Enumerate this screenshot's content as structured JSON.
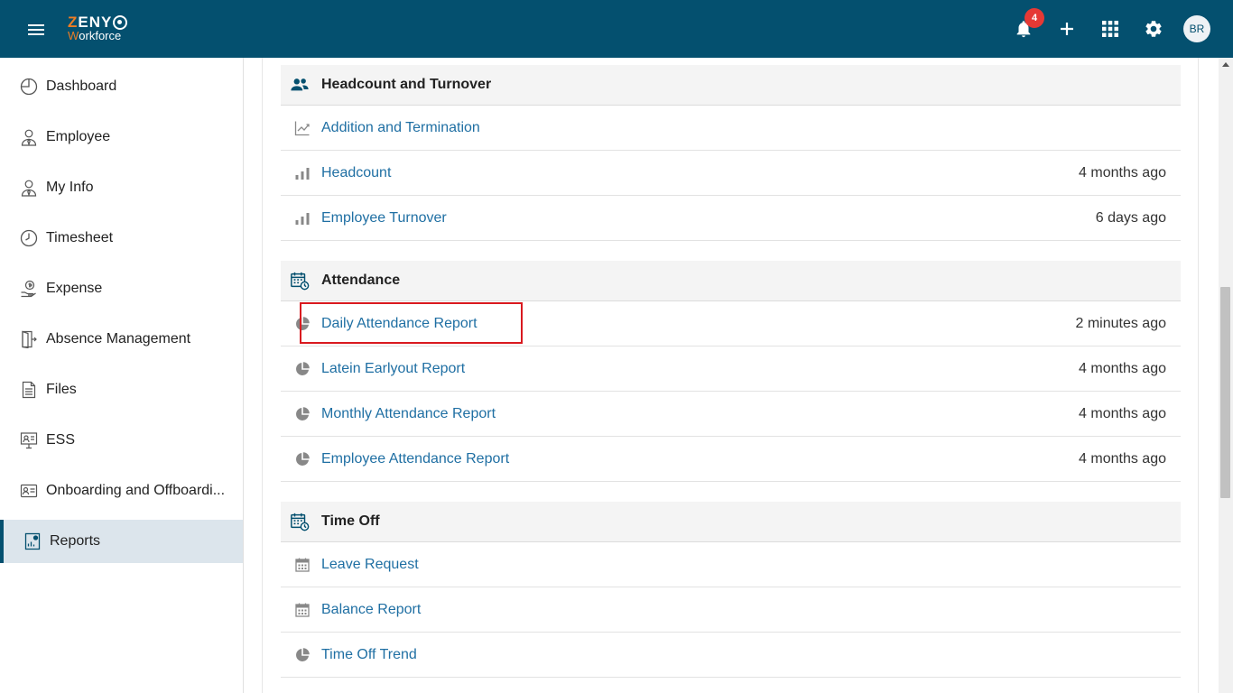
{
  "header": {
    "logo_top_accent": "Z",
    "logo_top_rest": "ENY",
    "logo_bottom_accent": "W",
    "logo_bottom_rest": "orkforce",
    "notification_count": "4",
    "avatar_initials": "BR"
  },
  "sidebar": {
    "items": [
      {
        "label": "Dashboard",
        "icon": "clock-pie-icon"
      },
      {
        "label": "Employee",
        "icon": "person-tie-icon"
      },
      {
        "label": "My Info",
        "icon": "person-tie-icon"
      },
      {
        "label": "Timesheet",
        "icon": "clock-icon"
      },
      {
        "label": "Expense",
        "icon": "money-hand-icon"
      },
      {
        "label": "Absence Management",
        "icon": "door-exit-icon"
      },
      {
        "label": "Files",
        "icon": "file-icon"
      },
      {
        "label": "ESS",
        "icon": "monitor-person-icon"
      },
      {
        "label": "Onboarding and Offboardi...",
        "icon": "id-card-icon"
      },
      {
        "label": "Reports",
        "icon": "report-icon",
        "active": true
      }
    ]
  },
  "sections": [
    {
      "title": "Headcount and Turnover",
      "icon": "people-icon",
      "rows": [
        {
          "label": "Addition and Termination",
          "time": "",
          "icon": "line-chart-icon"
        },
        {
          "label": "Headcount",
          "time": "4 months ago",
          "icon": "bar-chart-icon"
        },
        {
          "label": "Employee Turnover",
          "time": "6 days ago",
          "icon": "bar-chart-icon"
        }
      ]
    },
    {
      "title": "Attendance",
      "icon": "calendar-clock-icon",
      "rows": [
        {
          "label": "Daily Attendance Report",
          "time": "2 minutes ago",
          "icon": "pie-chart-icon"
        },
        {
          "label": "Latein Earlyout Report",
          "time": "4 months ago",
          "icon": "pie-chart-icon"
        },
        {
          "label": "Monthly Attendance Report",
          "time": "4 months ago",
          "icon": "pie-chart-icon"
        },
        {
          "label": "Employee Attendance Report",
          "time": "4 months ago",
          "icon": "pie-chart-icon"
        }
      ]
    },
    {
      "title": "Time Off",
      "icon": "calendar-clock-icon",
      "rows": [
        {
          "label": "Leave Request",
          "time": "",
          "icon": "calendar-icon"
        },
        {
          "label": "Balance Report",
          "time": "",
          "icon": "calendar-icon"
        },
        {
          "label": "Time Off Trend",
          "time": "",
          "icon": "pie-chart-icon"
        }
      ]
    }
  ],
  "colors": {
    "header_bg": "#04506f",
    "logo_accent": "#ee7d24",
    "link": "#1f6fa3",
    "badge": "#e53935",
    "highlight_border": "#d9191f",
    "active_sidebar_bg": "#dce5ec"
  }
}
